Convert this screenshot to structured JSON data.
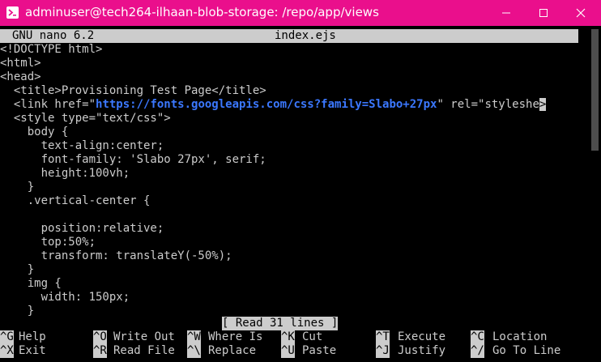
{
  "window": {
    "title": "adminuser@tech264-ilhaan-blob-storage: /repo/app/views",
    "titlebar_color": "#ea0f8c"
  },
  "nano": {
    "version": "GNU nano 6.2",
    "filename": "index.ejs",
    "status": "[ Read 31 lines ]"
  },
  "editor": {
    "lines": [
      "<!DOCTYPE html>",
      "<html>",
      "<head>",
      "  <title>Provisioning Test Page</title>",
      "  <link href=\"",
      "    body {",
      "      text-align:center;",
      "      font-family: 'Slabo 27px', serif;",
      "      height:100vh;",
      "    }",
      "    .vertical-center {",
      "",
      "      position:relative;",
      "      top:50%;",
      "      transform: translateY(-50%);",
      "    }",
      "    img {",
      "      width: 150px;",
      "    }"
    ],
    "link_url": "https://fonts.googleapis.com/css?family=Slabo+27px",
    "link_rest": "\" rel=\"styleshe",
    "overflow_marker": ">",
    "style_line": "  <style type=\"text/css\">",
    "url_color": "#3b78ff"
  },
  "shortcuts": [
    {
      "key": "^G",
      "label": "Help"
    },
    {
      "key": "^X",
      "label": "Exit"
    },
    {
      "key": "^O",
      "label": "Write Out"
    },
    {
      "key": "^R",
      "label": "Read File"
    },
    {
      "key": "^W",
      "label": "Where Is"
    },
    {
      "key": "^\\",
      "label": "Replace"
    },
    {
      "key": "^K",
      "label": "Cut"
    },
    {
      "key": "^U",
      "label": "Paste"
    },
    {
      "key": "^T",
      "label": "Execute"
    },
    {
      "key": "^J",
      "label": "Justify"
    },
    {
      "key": "^C",
      "label": "Location"
    },
    {
      "key": "^/",
      "label": "Go To Line"
    }
  ]
}
